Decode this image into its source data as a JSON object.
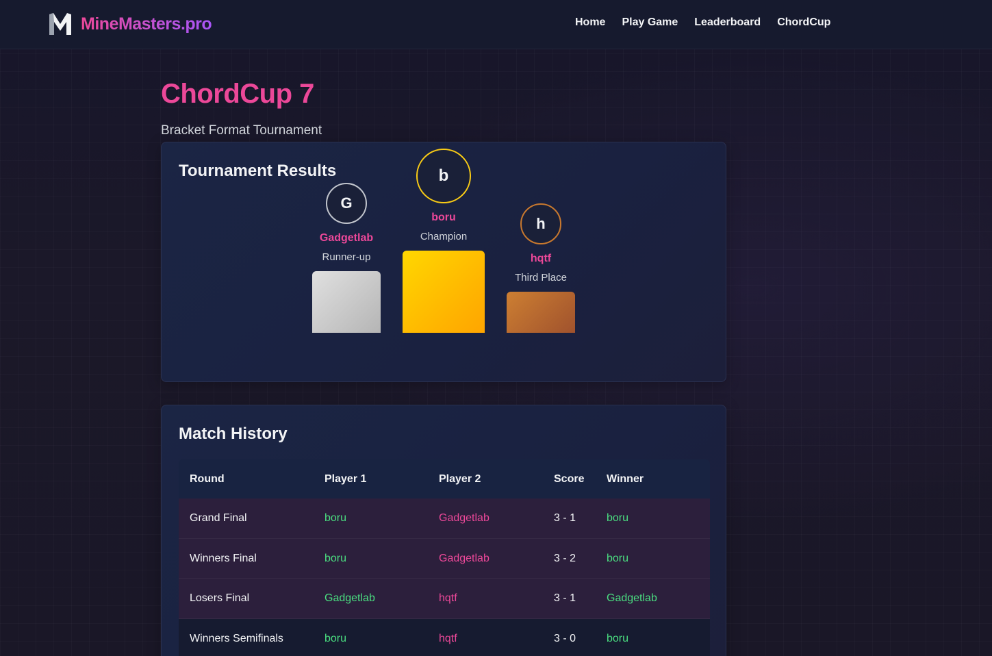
{
  "nav": {
    "brand": "MineMasters.pro",
    "links": [
      "Home",
      "Play Game",
      "Leaderboard",
      "ChordCup"
    ]
  },
  "page": {
    "title": "ChordCup 7",
    "subtitle": "Bracket Format Tournament"
  },
  "results": {
    "title": "Tournament Results",
    "champion": {
      "initial": "b",
      "name": "boru",
      "place": "Champion"
    },
    "runner_up": {
      "initial": "G",
      "name": "Gadgetlab",
      "place": "Runner-up"
    },
    "third": {
      "initial": "h",
      "name": "hqtf",
      "place": "Third Place"
    }
  },
  "history": {
    "title": "Match History",
    "columns": [
      "Round",
      "Player 1",
      "Player 2",
      "Score",
      "Winner"
    ],
    "rows": [
      {
        "round": "Grand Final",
        "p1": "boru",
        "p2": "Gadgetlab",
        "score": "3 - 1",
        "winner": "boru"
      },
      {
        "round": "Winners Final",
        "p1": "boru",
        "p2": "Gadgetlab",
        "score": "3 - 2",
        "winner": "boru"
      },
      {
        "round": "Losers Final",
        "p1": "Gadgetlab",
        "p2": "hqtf",
        "score": "3 - 1",
        "winner": "Gadgetlab"
      },
      {
        "round": "Winners Semifinals",
        "p1": "boru",
        "p2": "hqtf",
        "score": "3 - 0",
        "winner": "boru"
      }
    ]
  },
  "colors": {
    "accent_pink": "#ec4899",
    "win_green": "#4ade80",
    "gold": "#facc15",
    "silver": "#c0c0c0",
    "bronze": "#b87333"
  }
}
